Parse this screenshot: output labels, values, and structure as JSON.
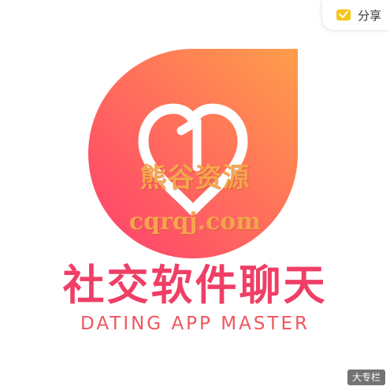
{
  "share": {
    "label": "分享",
    "icon": "share-icon"
  },
  "logo": {
    "icon": "heart-with-one-logo",
    "gradient_start": "#ff4a72",
    "gradient_end": "#ff9a4a"
  },
  "watermark": {
    "cn": "熊谷资源",
    "url": "cqrqj.com"
  },
  "title": "社交软件聊天",
  "subtitle": "DATING APP MASTER",
  "badge": "大专栏",
  "colors": {
    "title": "#ef3f66",
    "subtitle": "#f0555d",
    "watermark": "#f6a44e"
  }
}
